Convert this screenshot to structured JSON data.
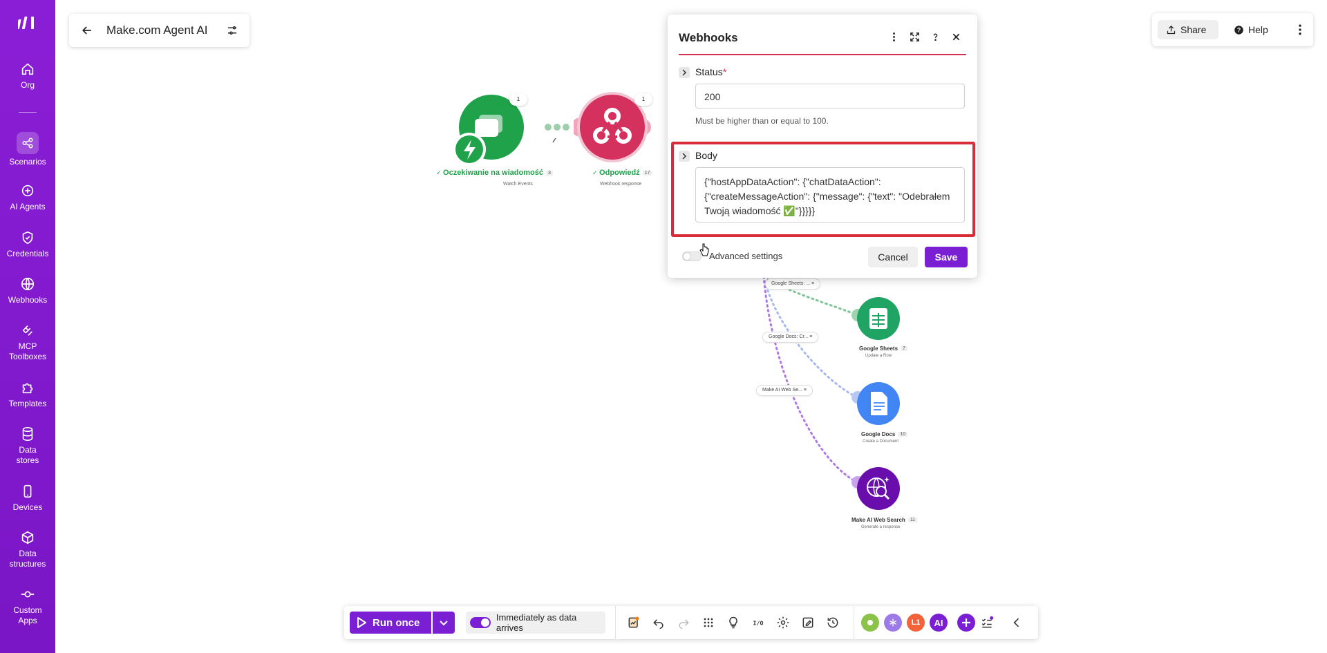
{
  "app": {
    "scenario_title": "Make.com Agent AI"
  },
  "sidebar": {
    "items": [
      {
        "label": "Org",
        "icon": "home-icon"
      },
      {
        "label": "Scenarios",
        "icon": "share-nodes-icon",
        "active": true
      },
      {
        "label": "AI Agents",
        "icon": "ai-agent-icon"
      },
      {
        "label": "Credentials",
        "icon": "shield-check-icon"
      },
      {
        "label": "Webhooks",
        "icon": "globe-icon"
      },
      {
        "label": "MCP Toolboxes",
        "icon": "mcp-icon"
      },
      {
        "label": "Templates",
        "icon": "puzzle-icon"
      },
      {
        "label": "Data stores",
        "icon": "database-icon"
      },
      {
        "label": "Devices",
        "icon": "mobile-icon"
      },
      {
        "label": "Data structures",
        "icon": "cube-icon"
      },
      {
        "label": "Custom Apps",
        "icon": "custom-app-icon"
      }
    ]
  },
  "top_right": {
    "share_label": "Share",
    "help_label": "Help"
  },
  "canvas": {
    "nodes": [
      {
        "label": "Oczekiwanie na wiadomość",
        "badge": "3",
        "sub": "Watch Events",
        "color": "#1fa24a",
        "chip": "1"
      },
      {
        "label": "Odpowiedź",
        "badge": "17",
        "sub": "Webhook response",
        "color": "#d4315e",
        "chip": "1"
      },
      {
        "label": "Google Sheets",
        "badge": "7",
        "sub": "Update a Row",
        "color": "#1fa463"
      },
      {
        "label": "Google Docs",
        "badge": "10",
        "sub": "Create a Document",
        "color": "#4285f4"
      },
      {
        "label": "Make AI Web Search",
        "badge": "11",
        "sub": "Generate a response",
        "color": "#6a0dad"
      }
    ],
    "route_labels": [
      "Google Sheets: ...",
      "Google Docs: Cr...",
      "Make AI Web Se..."
    ]
  },
  "dialog": {
    "title": "Webhooks",
    "status_label": "Status",
    "status_required_mark": "*",
    "status_value": "200",
    "status_helper": "Must be higher than or equal to 100.",
    "body_label": "Body",
    "body_value": "{\"hostAppDataAction\": {\"chatDataAction\": {\"createMessageAction\": {\"message\": {\"text\": \"Odebrałem Twoją wiadomość ✅\"}}}}}",
    "advanced_label": "Advanced settings",
    "cancel_label": "Cancel",
    "save_label": "Save",
    "accent_color": "#d32f4f"
  },
  "toolbar": {
    "run_label": "Run once",
    "schedule_label": "Immediately as data arrives",
    "avatars": [
      {
        "label": "",
        "color": "#8bc34a"
      },
      {
        "label": "",
        "color": "#9c7be8"
      },
      {
        "label": "L1",
        "color": "#f4623a"
      },
      {
        "label": "AI",
        "color": "#7a1fd4"
      }
    ]
  },
  "colors": {
    "brand_purple": "#7a1fd4",
    "sidebar": "#8a1ed6",
    "highlight_red": "#d82c3a"
  }
}
